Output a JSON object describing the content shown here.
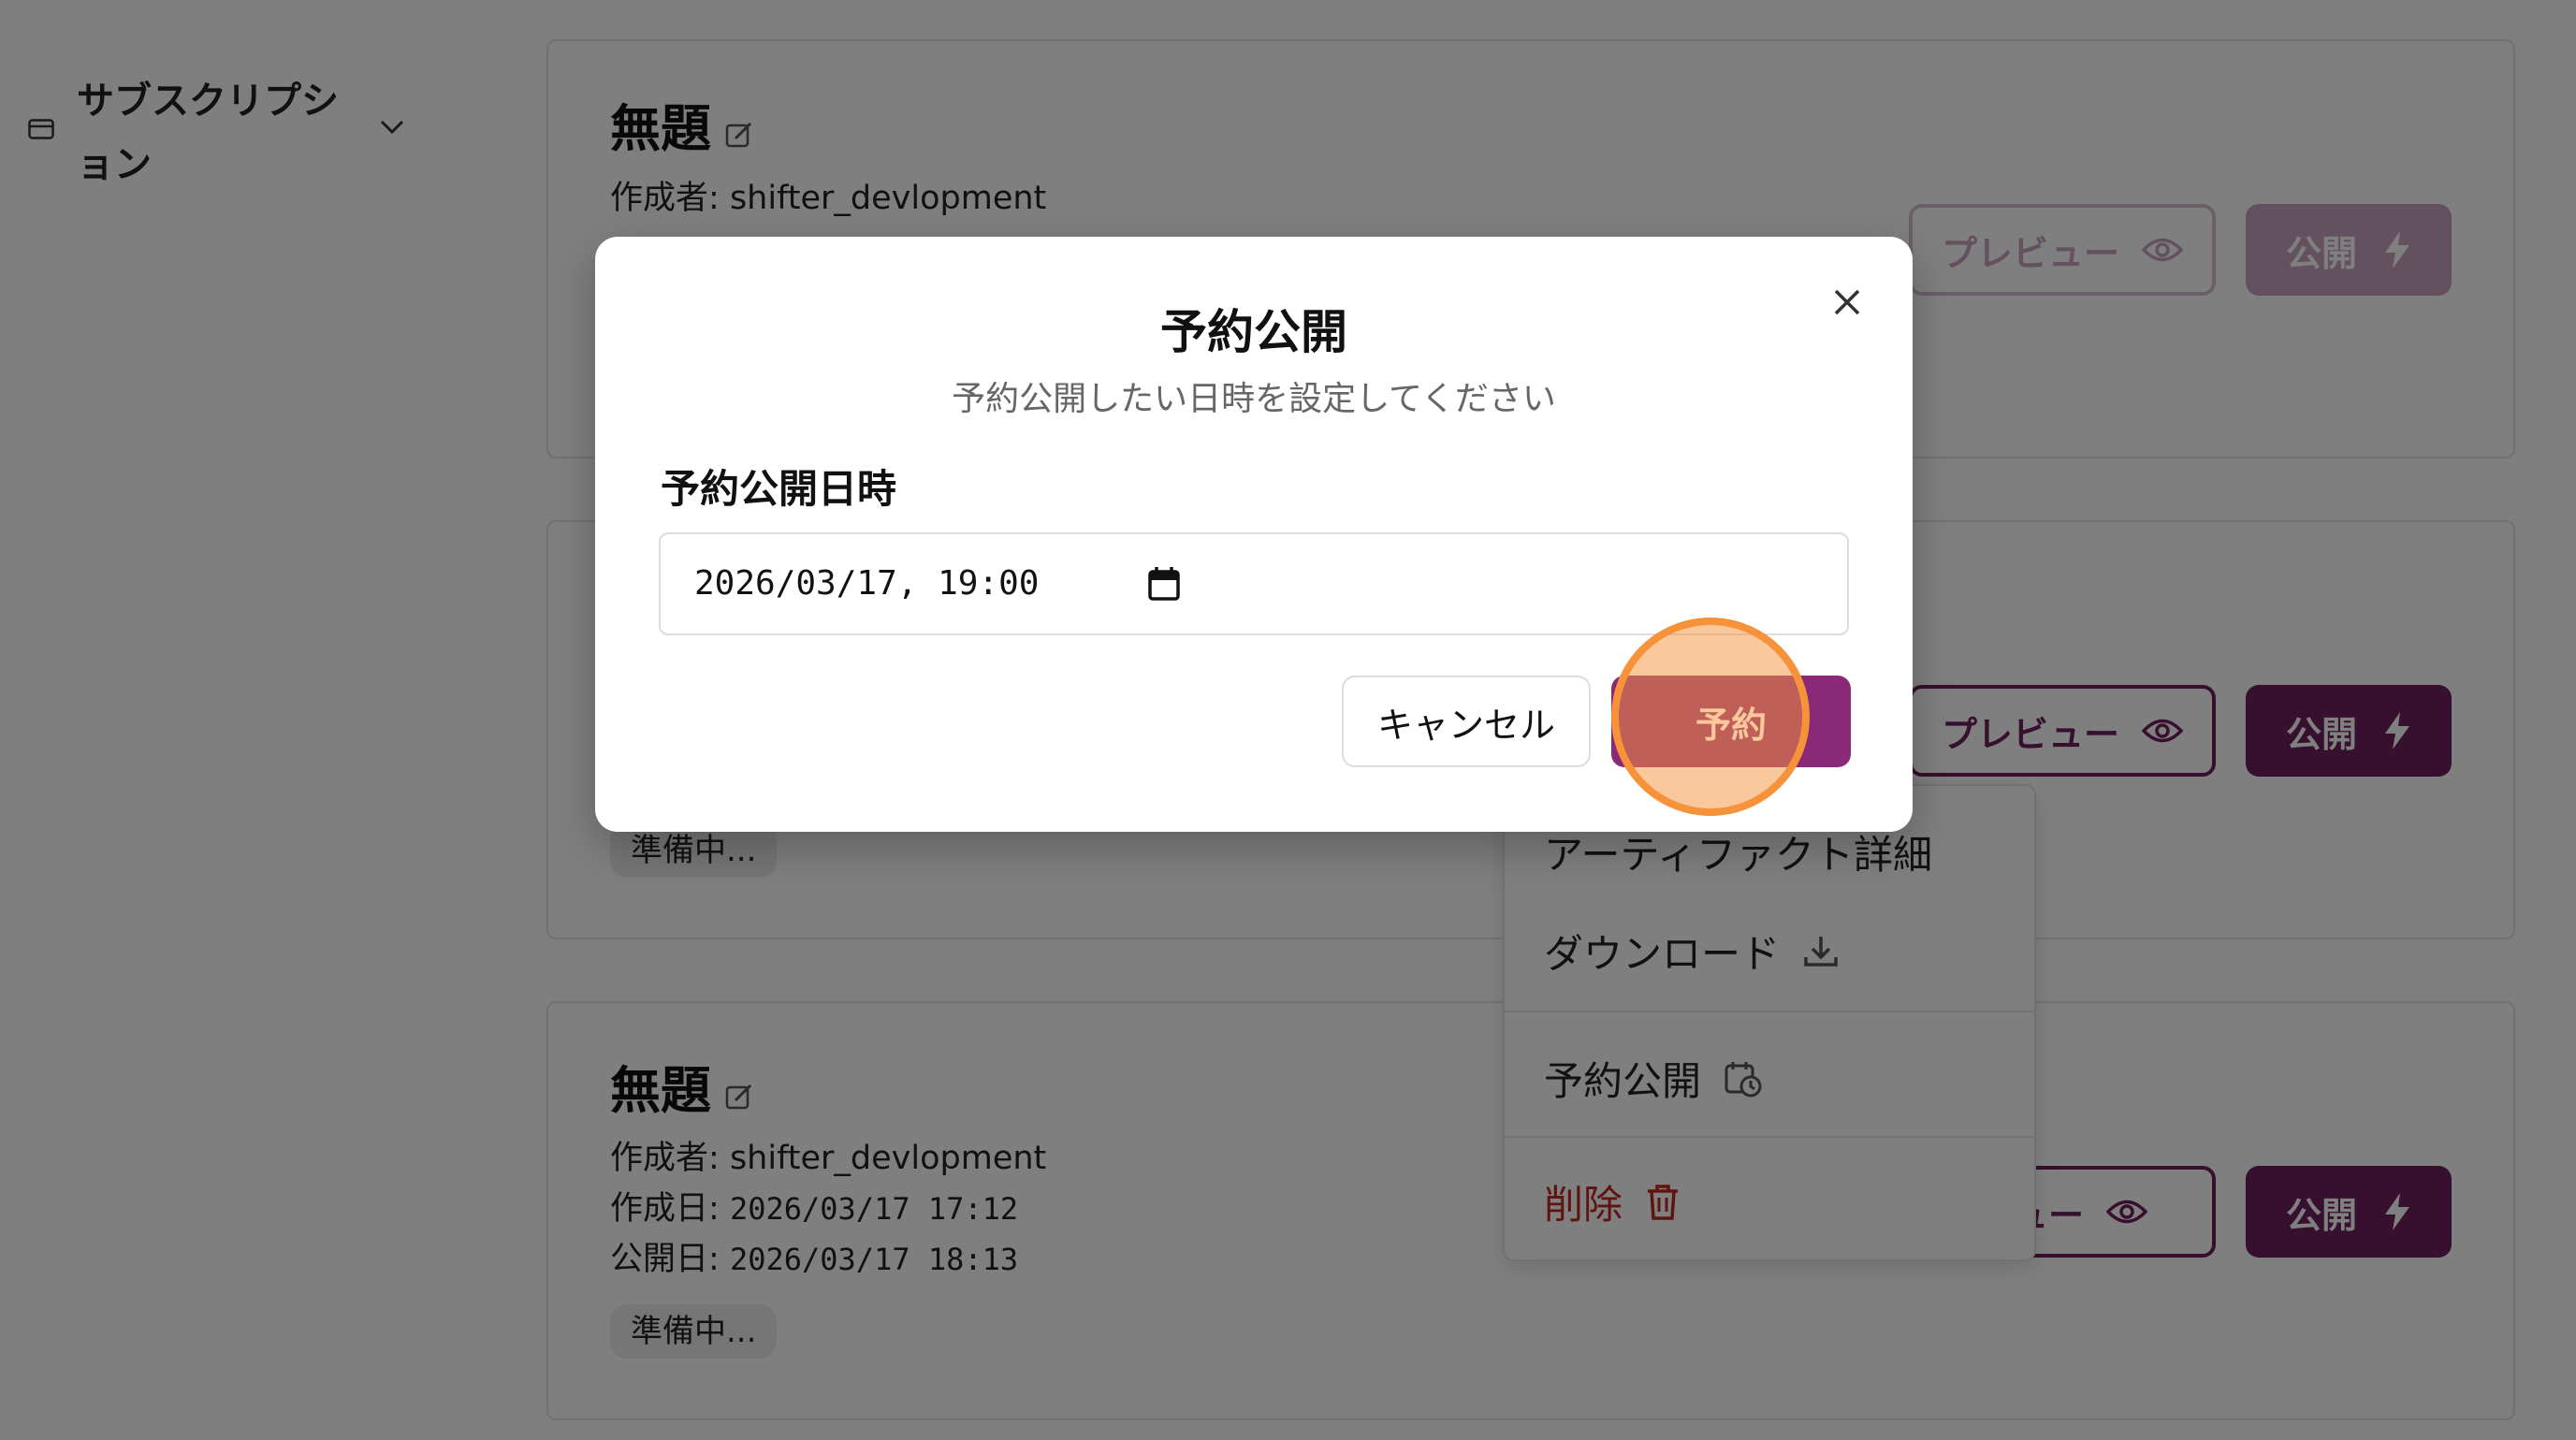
{
  "sidebar": {
    "subscription": {
      "label": "サブスクリプション",
      "icon": "credit-card-icon"
    }
  },
  "cards": [
    {
      "title": "無題",
      "author_label": "作成者:",
      "author": "shifter_devlopment",
      "buttons": {
        "preview": "プレビュー",
        "publish": "公開"
      }
    },
    {
      "status": "準備中...",
      "buttons": {
        "preview": "プレビュー",
        "publish": "公開"
      }
    },
    {
      "title": "無題",
      "author_label": "作成者:",
      "author": "shifter_devlopment",
      "created_label": "作成日:",
      "created": "2026/03/17 17:12",
      "published_label": "公開日:",
      "published": "2026/03/17 18:13",
      "status": "準備中...",
      "buttons": {
        "preview": "ビュー",
        "publish": "公開"
      }
    }
  ],
  "menu": {
    "items": [
      {
        "label": "アーティファクト詳細"
      },
      {
        "label": "ダウンロード",
        "icon": "download-icon"
      },
      {
        "label": "予約公開",
        "icon": "calendar-clock-icon"
      },
      {
        "label": "削除",
        "icon": "trash-icon",
        "color": "#c0291f"
      }
    ]
  },
  "dialog": {
    "title": "予約公開",
    "subtitle": "予約公開したい日時を設定してください",
    "field_label": "予約公開日時",
    "datetime_value": "2026/03/17, 19:00",
    "cancel_label": "キャンセル",
    "schedule_label": "予約"
  },
  "colors": {
    "brand": "#6e1f5e",
    "danger": "#c0291f",
    "click_marker": "#f5923a"
  }
}
